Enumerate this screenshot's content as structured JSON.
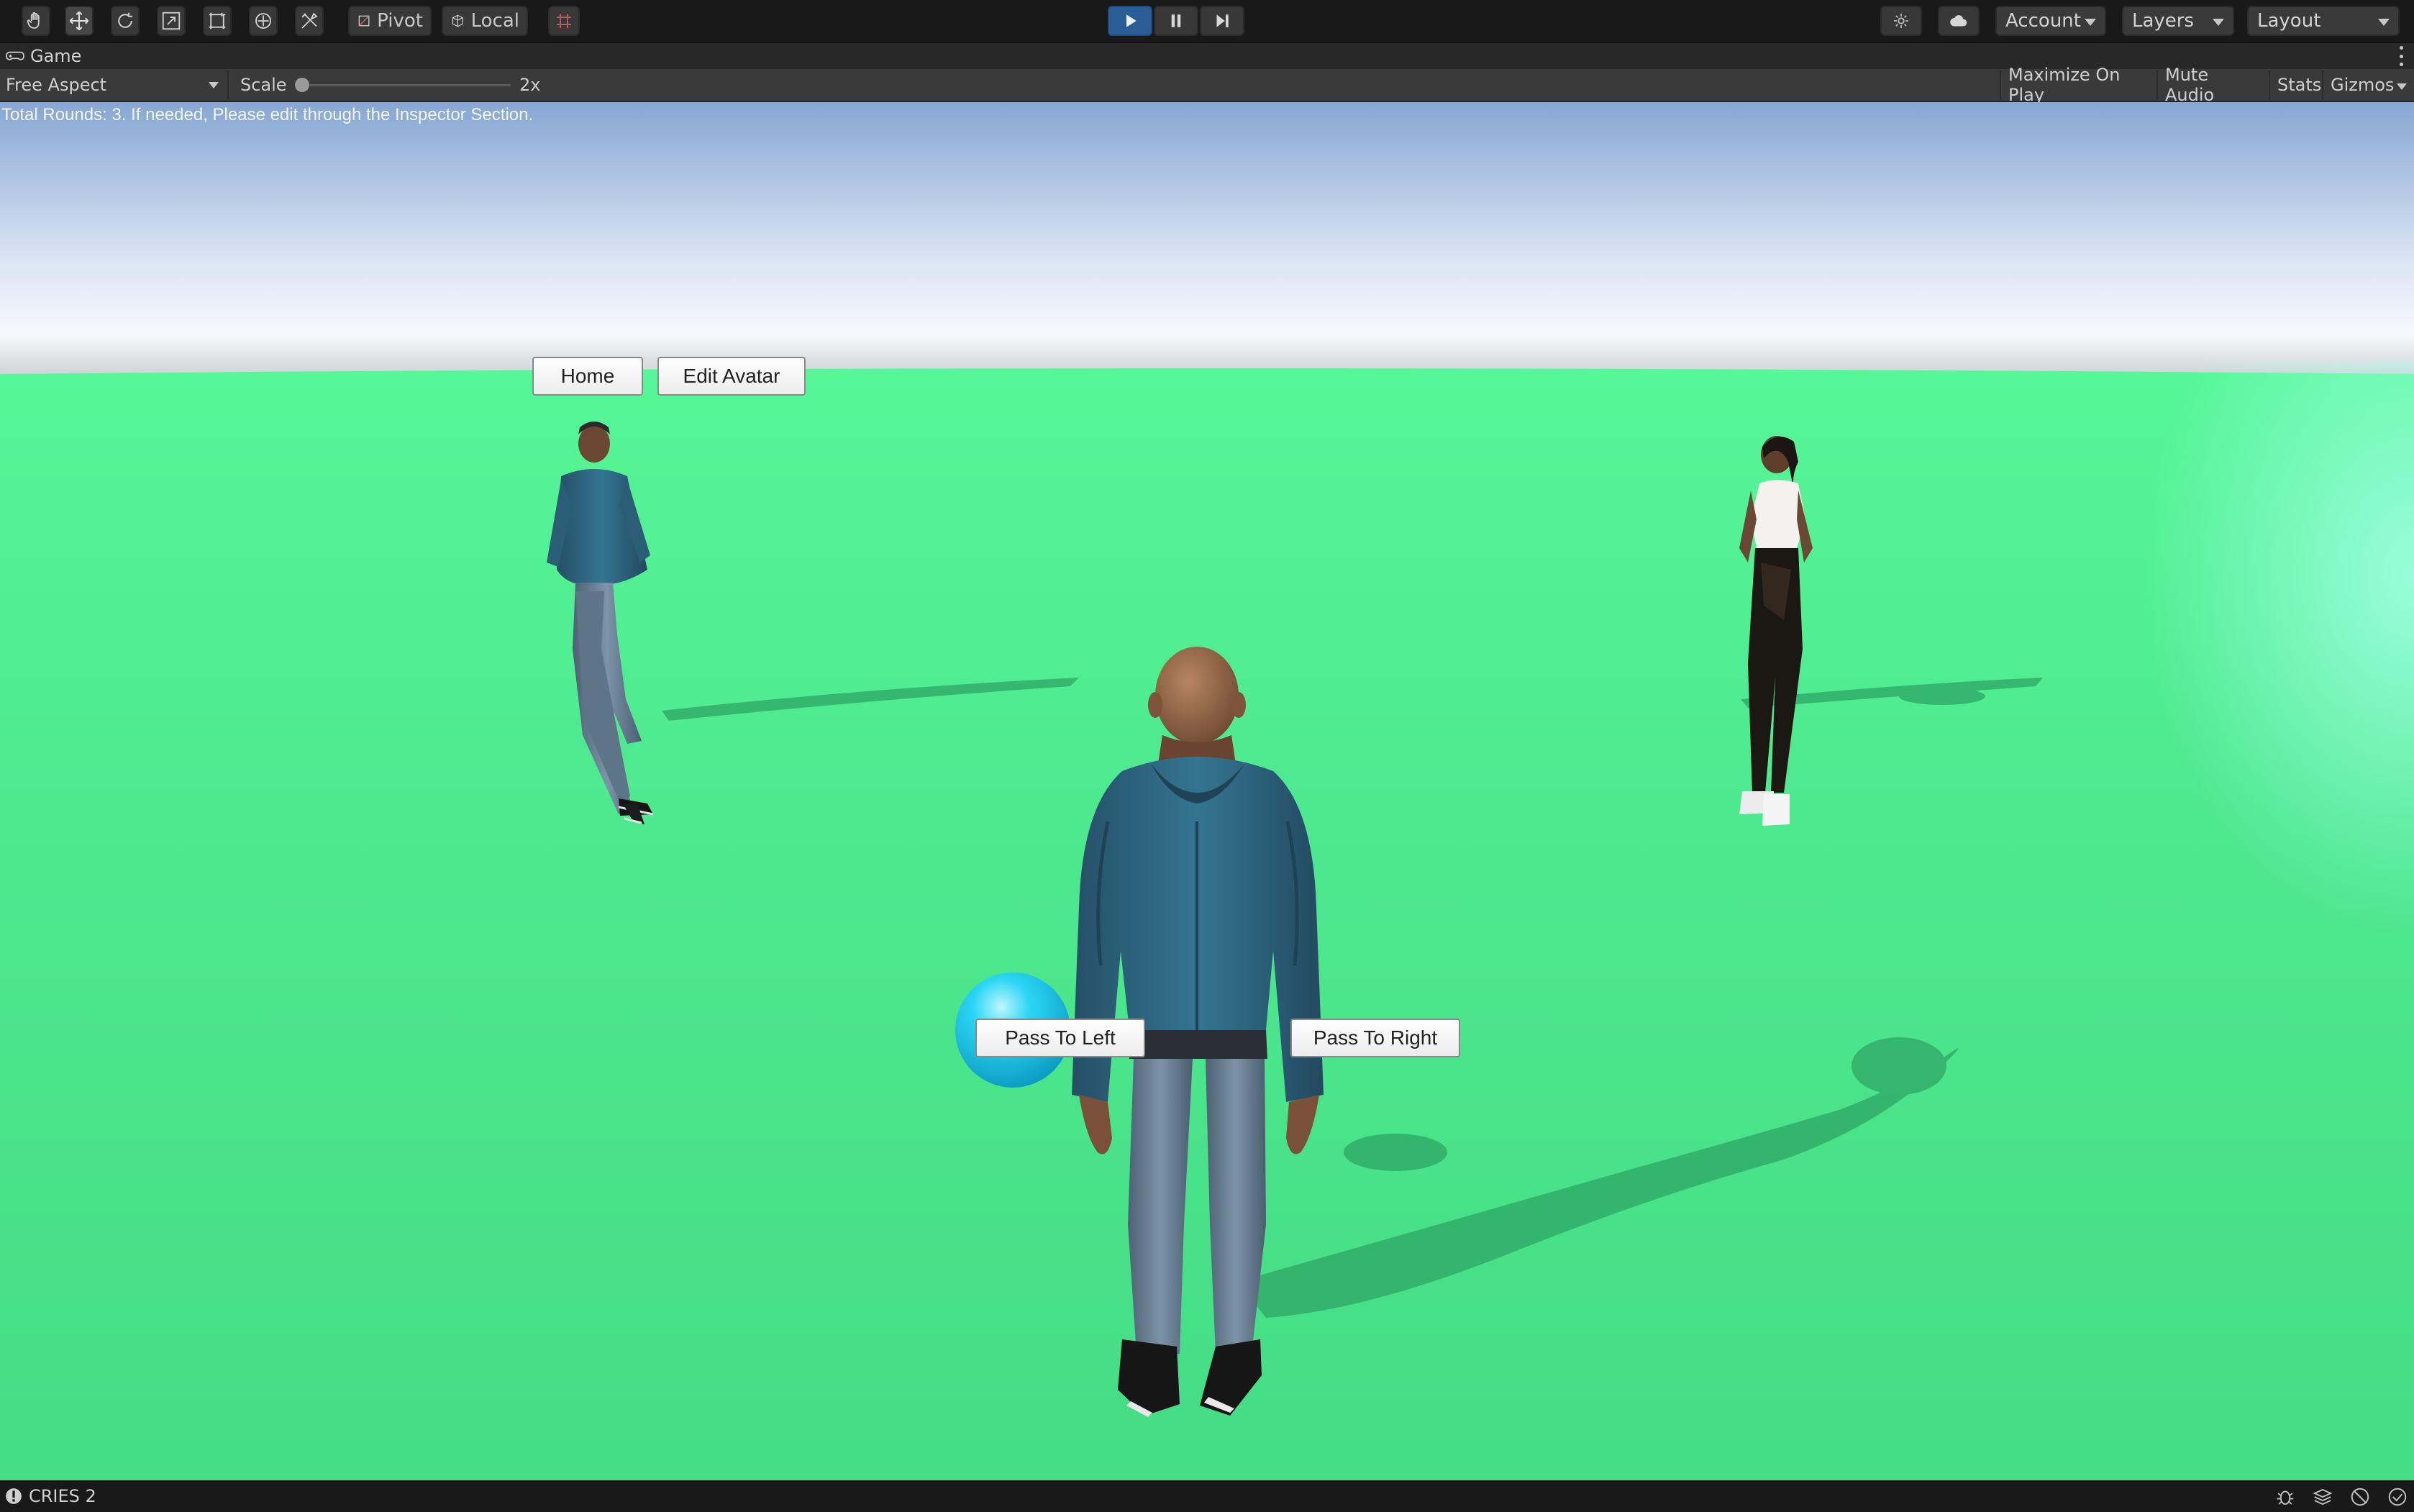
{
  "toolbar": {
    "tools": [
      "hand-icon",
      "move-icon",
      "rotate-icon",
      "scale-icon",
      "rect-icon",
      "transform-icon",
      "custom-tool-icon"
    ],
    "pivot_label": "Pivot",
    "local_label": "Local",
    "account_label": "Account",
    "layers_label": "Layers",
    "layout_label": "Layout"
  },
  "tab": {
    "label": "Game"
  },
  "gamebar": {
    "aspect": "Free Aspect",
    "scale_label": "Scale",
    "scale_value": "2x",
    "maximize_label": "Maximize On Play",
    "mute_label": "Mute Audio",
    "stats_label": "Stats",
    "gizmos_label": "Gizmos"
  },
  "game": {
    "info_text": "Total Rounds: 3. If needed, Please edit through the Inspector Section.",
    "home_label": "Home",
    "edit_avatar_label": "Edit Avatar",
    "pass_left_label": "Pass To Left",
    "pass_right_label": "Pass To Right"
  },
  "status": {
    "message": "CRIES 2"
  },
  "colors": {
    "ground": "#4de88b",
    "sky_top": "#8aa9d6",
    "play_active": "#2a5d95",
    "ball": "#1fc9e8",
    "jacket": "#2f6a86"
  }
}
